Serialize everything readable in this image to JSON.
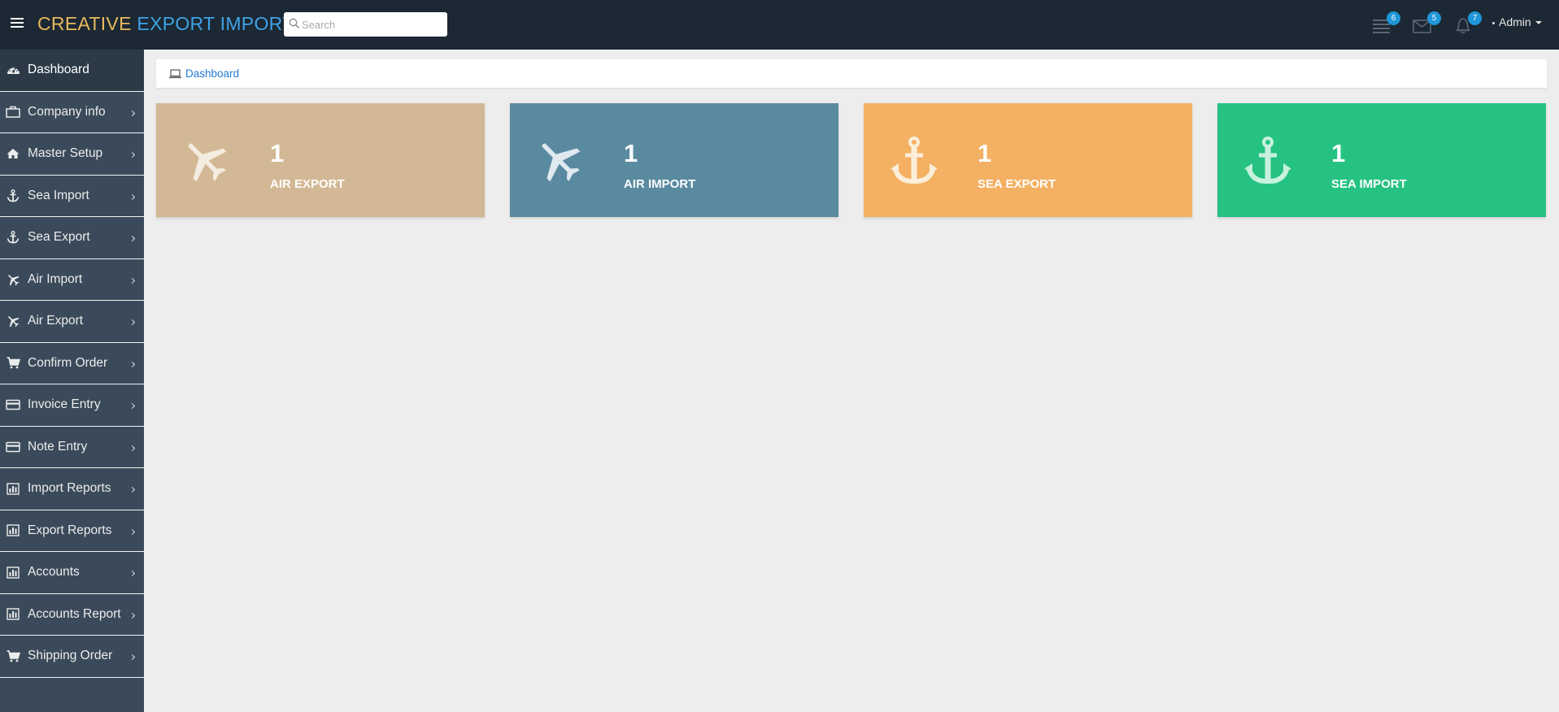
{
  "app": {
    "brand_part1": "CREATIVE",
    "brand_part2": "EXPORT IMPORT",
    "search_placeholder": "Search"
  },
  "header": {
    "tasks_badge": "6",
    "messages_badge": "5",
    "notifications_badge": "7",
    "user_label": "Admin"
  },
  "sidebar": {
    "items": [
      {
        "label": "Dashboard",
        "icon": "dashboard-icon"
      },
      {
        "label": "Company info",
        "icon": "briefcase-icon"
      },
      {
        "label": "Master Setup",
        "icon": "home-icon"
      },
      {
        "label": "Sea Import",
        "icon": "anchor-icon"
      },
      {
        "label": "Sea Export",
        "icon": "anchor-icon"
      },
      {
        "label": "Air Import",
        "icon": "plane-icon"
      },
      {
        "label": "Air Export",
        "icon": "plane-icon"
      },
      {
        "label": "Confirm Order",
        "icon": "cart-icon"
      },
      {
        "label": "Invoice Entry",
        "icon": "credit-card-icon"
      },
      {
        "label": "Note Entry",
        "icon": "credit-card-icon"
      },
      {
        "label": "Import Reports",
        "icon": "bar-chart-icon"
      },
      {
        "label": "Export Reports",
        "icon": "bar-chart-icon"
      },
      {
        "label": "Accounts",
        "icon": "bar-chart-icon"
      },
      {
        "label": "Accounts Report",
        "icon": "bar-chart-icon"
      },
      {
        "label": "Shipping Order",
        "icon": "cart-icon"
      }
    ]
  },
  "breadcrumb": {
    "label": "Dashboard"
  },
  "cards": [
    {
      "value": "1",
      "label": "AIR EXPORT",
      "color": "#d2b894",
      "icon_color": "#f4ece0",
      "icon": "plane-icon"
    },
    {
      "value": "1",
      "label": "AIR IMPORT",
      "color": "#5a8aa0",
      "icon_color": "#dfe9ef",
      "icon": "plane-icon"
    },
    {
      "value": "1",
      "label": "SEA EXPORT",
      "color": "#f4b063",
      "icon_color": "#fbefd9",
      "icon": "anchor-icon"
    },
    {
      "value": "1",
      "label": "SEA IMPORT",
      "color": "#26c281",
      "icon_color": "#c8f1df",
      "icon": "anchor-icon"
    }
  ],
  "colors": {
    "topbar": "#1c2833",
    "sidebar": "#3a4a5a",
    "link": "#1f7ad4",
    "badge": "#1e96d8"
  }
}
